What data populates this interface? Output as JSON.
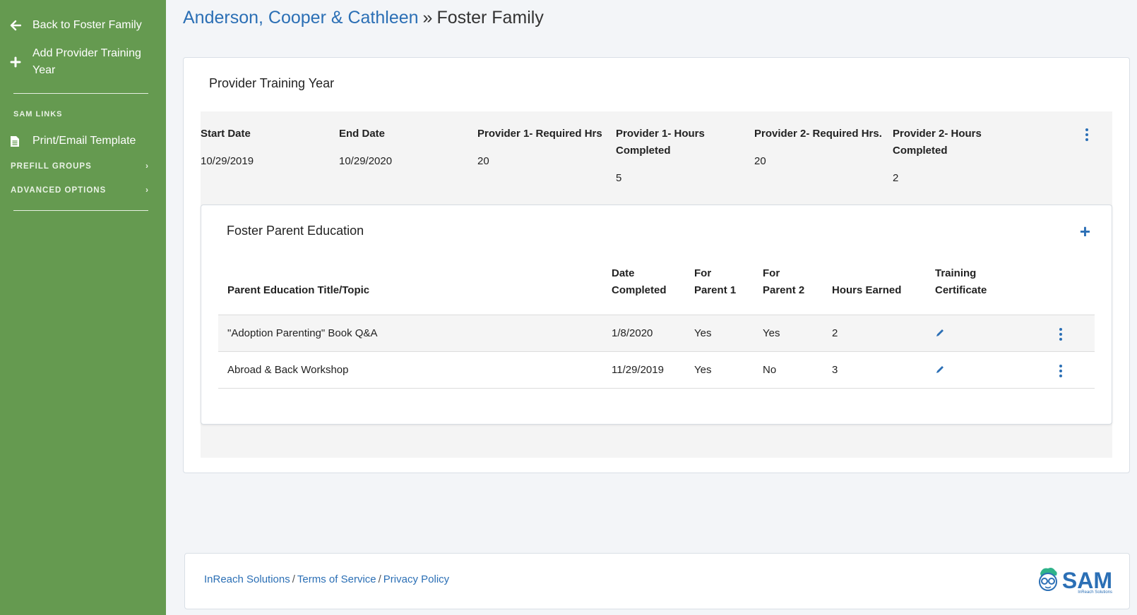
{
  "sidebar": {
    "back_label": "Back to Foster Family",
    "add_label": "Add Provider Training Year",
    "links_heading": "SAM LINKS",
    "print_label": "Print/Email Template",
    "prefill_label": "PREFILL GROUPS",
    "advanced_label": "ADVANCED OPTIONS"
  },
  "title": {
    "family_link": "Anderson, Cooper & Cathleen",
    "separator": "»",
    "current": "Foster Family"
  },
  "training_year": {
    "card_title": "Provider Training Year",
    "columns": [
      {
        "label": "Start Date",
        "value": "10/29/2019"
      },
      {
        "label": "End Date",
        "value": "10/29/2020"
      },
      {
        "label": "Provider 1- Required Hrs",
        "value": "20"
      },
      {
        "label": "Provider 1- Hours Completed",
        "value": "5"
      },
      {
        "label": "Provider 2- Required Hrs.",
        "value": "20"
      },
      {
        "label": "Provider 2- Hours Completed",
        "value": "2"
      }
    ]
  },
  "education": {
    "title": "Foster Parent Education",
    "headers": {
      "topic": "Parent Education Title/Topic",
      "date": "Date Completed",
      "parent1": "For Parent 1",
      "parent2": "For Parent 2",
      "hours": "Hours Earned",
      "certificate": "Training Certificate"
    },
    "rows": [
      {
        "topic": "\"Adoption Parenting\" Book Q&A",
        "date": "1/8/2020",
        "parent1": "Yes",
        "parent2": "Yes",
        "hours": "2"
      },
      {
        "topic": "Abroad & Back Workshop",
        "date": "11/29/2019",
        "parent1": "Yes",
        "parent2": "No",
        "hours": "3"
      }
    ]
  },
  "footer": {
    "link1": "InReach Solutions",
    "link2": "Terms of Service",
    "link3": "Privacy Policy",
    "sep": "/",
    "logo_text": "SAM",
    "logo_sub": "InReach Solutions"
  },
  "colors": {
    "sidebar": "#659a50",
    "accent": "#2b6fb5"
  }
}
